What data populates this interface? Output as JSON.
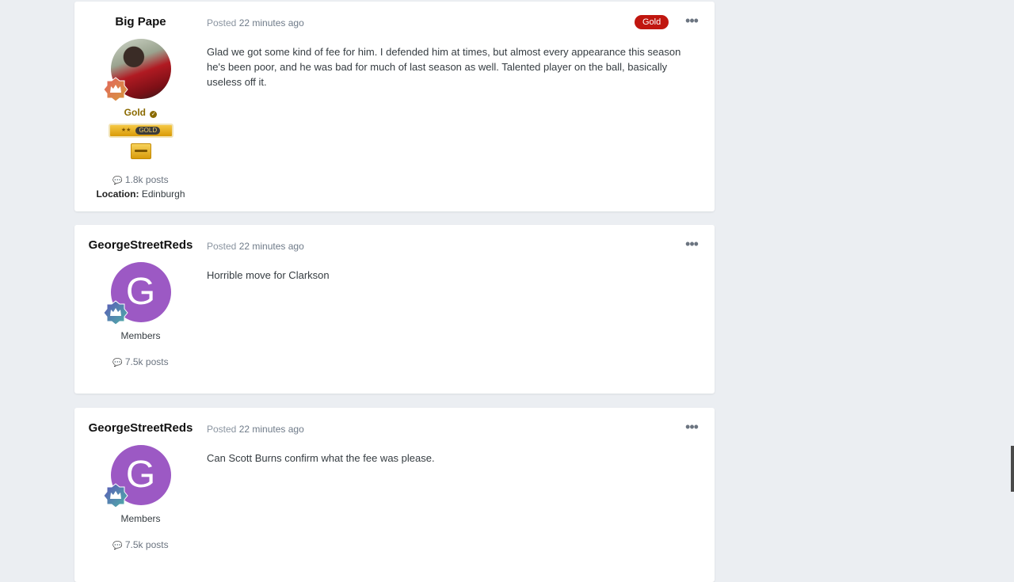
{
  "posts": [
    {
      "author": "Big Pape",
      "avatar_type": "photo",
      "group": "Gold",
      "badge_label": "GOLD",
      "posted_label": "Posted",
      "time": "22 minutes ago",
      "tag": "Gold",
      "content": "Glad we got some kind of fee for him. I defended him at times, but almost every appearance this season he's been poor, and he was bad for much of last season as well. Talented player on the ball, basically useless off it.",
      "posts_count": "1.8k posts",
      "location_label": "Location:",
      "location": "Edinburgh"
    },
    {
      "author": "GeorgeStreetReds",
      "avatar_letter": "G",
      "group": "Members",
      "posted_label": "Posted",
      "time": "22 minutes ago",
      "content": "Horrible move for Clarkson",
      "posts_count": "7.5k posts"
    },
    {
      "author": "GeorgeStreetReds",
      "avatar_letter": "G",
      "group": "Members",
      "posted_label": "Posted",
      "time": "22 minutes ago",
      "content": "Can Scott Burns confirm what the fee was please.",
      "posts_count": "7.5k posts"
    }
  ],
  "icons": {
    "more": "more-options-icon",
    "comment": "comment-icon",
    "rank": "crown-rank-icon",
    "verified": "check-icon"
  },
  "colors": {
    "gold_tag": "#c0160f",
    "avatar_letter_bg": "#9c59c4",
    "gold_text": "#8a6a00"
  }
}
